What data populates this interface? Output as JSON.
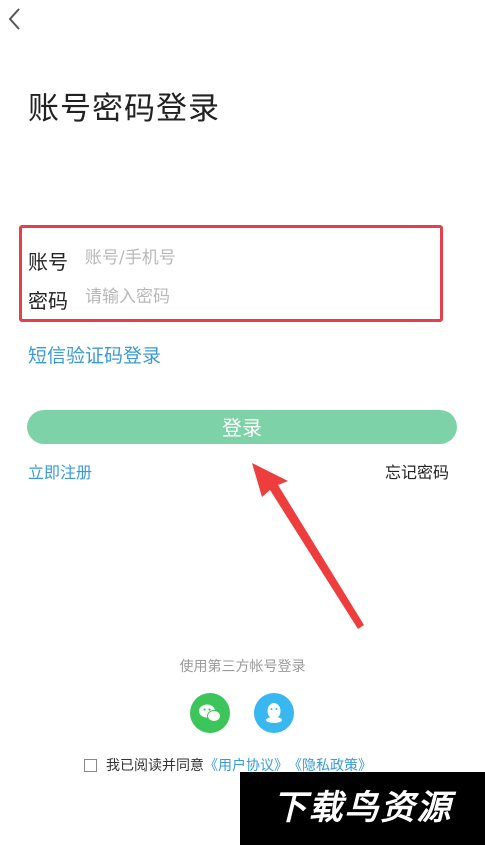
{
  "nav": {
    "back_icon": "chevron-left-icon"
  },
  "page": {
    "title": "账号密码登录"
  },
  "form": {
    "account_label": "账号",
    "account_placeholder": "账号/手机号",
    "password_label": "密码",
    "password_placeholder": "请输入密码"
  },
  "links": {
    "sms_login": "短信验证码登录",
    "register": "立即注册",
    "forgot_password": "忘记密码"
  },
  "login_button": {
    "label": "登录",
    "color": "#7dd3a7"
  },
  "third_party": {
    "caption": "使用第三方帐号登录",
    "providers": [
      {
        "name": "wechat",
        "icon": "wechat-icon",
        "color": "#3cc55a"
      },
      {
        "name": "qq",
        "icon": "qq-icon",
        "color": "#38b7f0"
      }
    ]
  },
  "agreement": {
    "text": "我已阅读并同意",
    "user_agreement": "《用户协议》",
    "privacy_policy": "《隐私政策》"
  },
  "watermark": {
    "text": "下载鸟资源"
  },
  "colors": {
    "accent": "#3a9ad6",
    "highlight_box": "#e53f4c",
    "arrow": "#ee3d3d"
  }
}
